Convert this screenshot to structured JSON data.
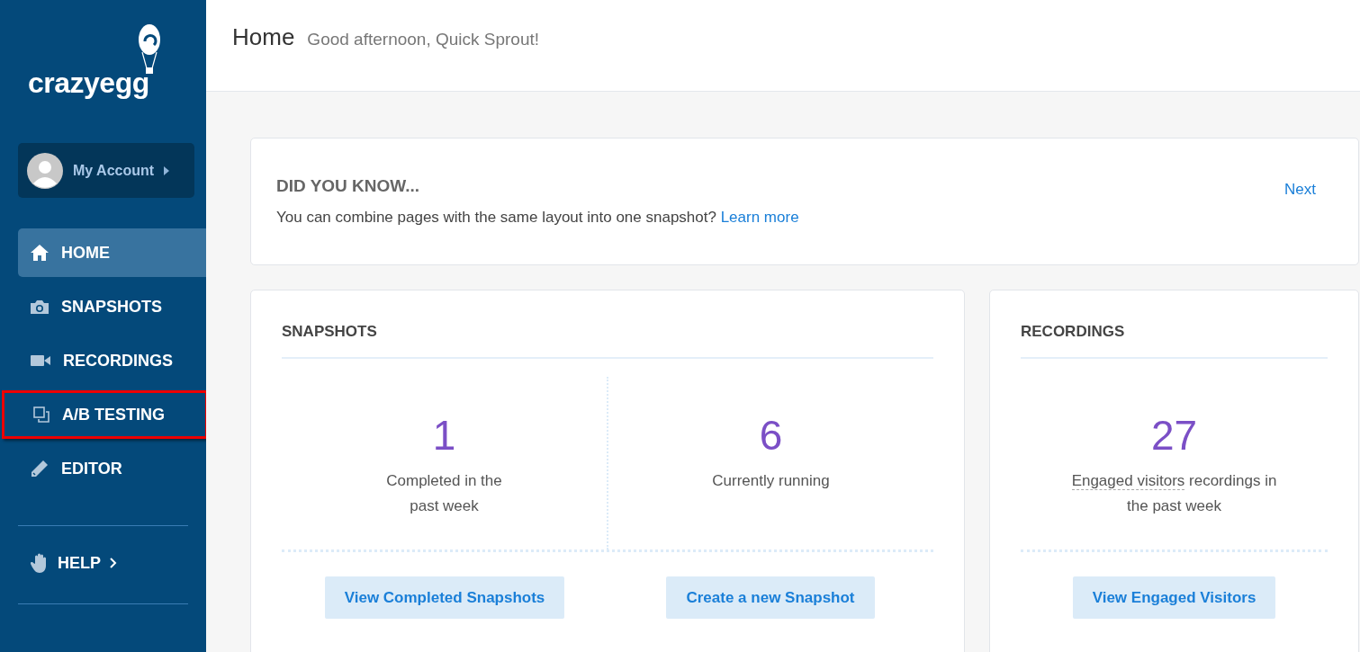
{
  "sidebar": {
    "logo": "crazyegg",
    "account": {
      "label": "My Account"
    },
    "nav": [
      {
        "label": "HOME",
        "kind": "home",
        "selected": true,
        "highlighted": false
      },
      {
        "label": "SNAPSHOTS",
        "kind": "camera",
        "selected": false,
        "highlighted": false
      },
      {
        "label": "RECORDINGS",
        "kind": "video",
        "selected": false,
        "highlighted": false
      },
      {
        "label": "A/B TESTING",
        "kind": "ab",
        "selected": false,
        "highlighted": true
      },
      {
        "label": "EDITOR",
        "kind": "pencil",
        "selected": false,
        "highlighted": false
      }
    ],
    "help": {
      "label": "HELP"
    }
  },
  "header": {
    "title": "Home",
    "greeting": "Good afternoon, Quick Sprout!"
  },
  "tip": {
    "heading": "DID YOU KNOW...",
    "text": "You can combine pages with the same layout into one snapshot?",
    "link": "Learn more",
    "next": "Next"
  },
  "snapshots": {
    "title": "SNAPSHOTS",
    "stats": [
      {
        "value": "1",
        "label": "Completed in the past week"
      },
      {
        "value": "6",
        "label": "Currently running"
      }
    ],
    "buttons": [
      "View Completed Snapshots",
      "Create a new Snapshot"
    ]
  },
  "recordings": {
    "title": "RECORDINGS",
    "stat": {
      "value": "27",
      "term": "Engaged visitors",
      "label": "recordings in the past week"
    },
    "buttons": [
      "View Engaged Visitors"
    ]
  }
}
